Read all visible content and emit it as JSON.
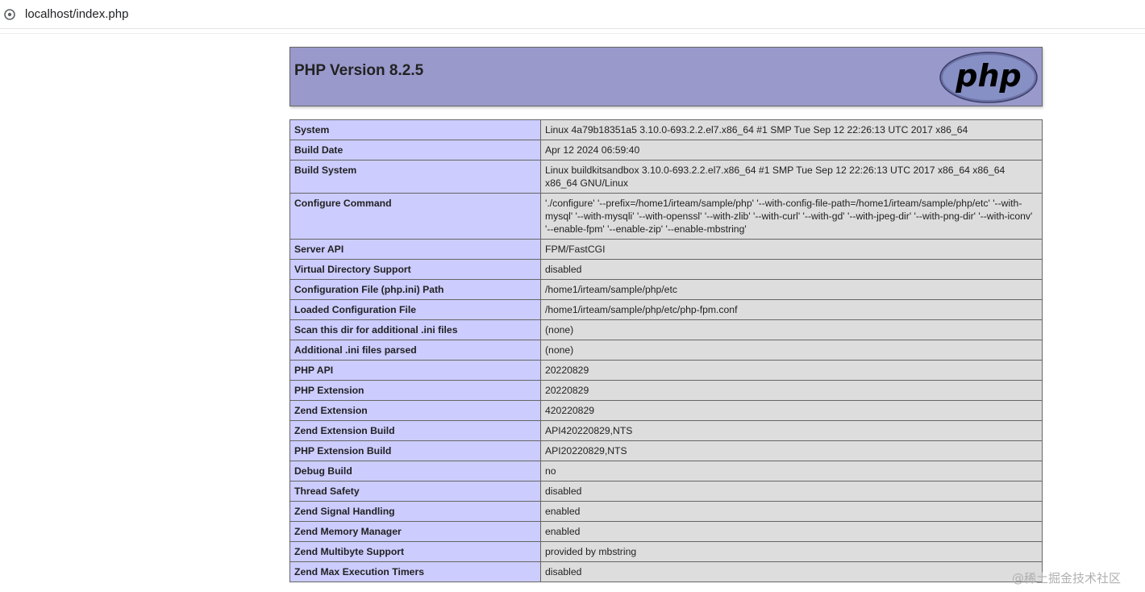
{
  "browser": {
    "url": "localhost/index.php"
  },
  "header": {
    "title": "PHP Version 8.2.5",
    "logo_text": "php"
  },
  "rows": [
    {
      "key": "System",
      "value": "Linux 4a79b18351a5 3.10.0-693.2.2.el7.x86_64 #1 SMP Tue Sep 12 22:26:13 UTC 2017 x86_64"
    },
    {
      "key": "Build Date",
      "value": "Apr 12 2024 06:59:40"
    },
    {
      "key": "Build System",
      "value": "Linux buildkitsandbox 3.10.0-693.2.2.el7.x86_64 #1 SMP Tue Sep 12 22:26:13 UTC 2017 x86_64 x86_64 x86_64 GNU/Linux"
    },
    {
      "key": "Configure Command",
      "value": "'./configure' '--prefix=/home1/irteam/sample/php' '--with-config-file-path=/home1/irteam/sample/php/etc' '--with-mysql' '--with-mysqli' '--with-openssl' '--with-zlib' '--with-curl' '--with-gd' '--with-jpeg-dir' '--with-png-dir' '--with-iconv' '--enable-fpm' '--enable-zip' '--enable-mbstring'"
    },
    {
      "key": "Server API",
      "value": "FPM/FastCGI"
    },
    {
      "key": "Virtual Directory Support",
      "value": "disabled"
    },
    {
      "key": "Configuration File (php.ini) Path",
      "value": "/home1/irteam/sample/php/etc"
    },
    {
      "key": "Loaded Configuration File",
      "value": "/home1/irteam/sample/php/etc/php-fpm.conf"
    },
    {
      "key": "Scan this dir for additional .ini files",
      "value": "(none)"
    },
    {
      "key": "Additional .ini files parsed",
      "value": "(none)"
    },
    {
      "key": "PHP API",
      "value": "20220829"
    },
    {
      "key": "PHP Extension",
      "value": "20220829"
    },
    {
      "key": "Zend Extension",
      "value": "420220829"
    },
    {
      "key": "Zend Extension Build",
      "value": "API420220829,NTS"
    },
    {
      "key": "PHP Extension Build",
      "value": "API20220829,NTS"
    },
    {
      "key": "Debug Build",
      "value": "no"
    },
    {
      "key": "Thread Safety",
      "value": "disabled"
    },
    {
      "key": "Zend Signal Handling",
      "value": "enabled"
    },
    {
      "key": "Zend Memory Manager",
      "value": "enabled"
    },
    {
      "key": "Zend Multibyte Support",
      "value": "provided by mbstring"
    },
    {
      "key": "Zend Max Execution Timers",
      "value": "disabled"
    }
  ],
  "watermark": "@稀土掘金技术社区",
  "colors": {
    "header_bg": "#9999cc",
    "key_bg": "#ccccff",
    "value_bg": "#dddddd"
  }
}
